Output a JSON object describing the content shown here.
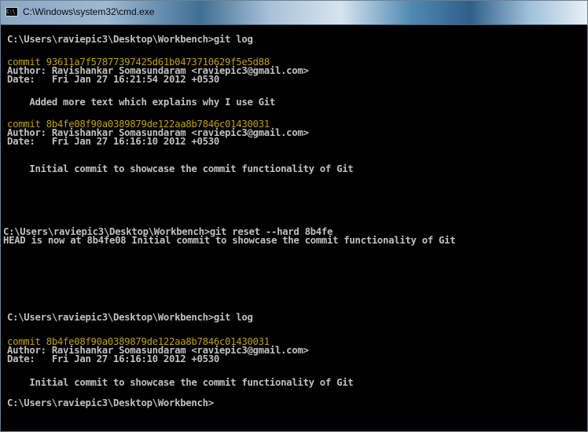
{
  "window": {
    "title": "C:\\Windows\\system32\\cmd.exe",
    "icon": "cmd-icon"
  },
  "console": {
    "lines": [
      "C:\\Users\\raviepic3\\Desktop\\Workbench>git log",
      "commit 93611a7f57877397425d61b0473710629f5e5d88",
      "Author: Ravishankar Somasundaram <raviepic3@gmail.com>",
      "Date:   Fri Jan 27 16:21:54 2012 +0530",
      "    Added more text which explains why I use Git",
      "commit 8b4fe08f90a0389879de122aa8b7846c01430031",
      "Author: Ravishankar Somasundaram <raviepic3@gmail.com>",
      "Date:   Fri Jan 27 16:16:10 2012 +0530",
      "    Initial commit to showcase the commit functionality of Git",
      "C:\\Users\\raviepic3\\Desktop\\Workbench>git reset --hard 8b4fe",
      "HEAD is now at 8b4fe08 Initial commit to showcase the commit functionality of Git",
      "C:\\Users\\raviepic3\\Desktop\\Workbench>git log",
      "commit 8b4fe08f90a0389879de122aa8b7846c01430031",
      "Author: Ravishankar Somasundaram <raviepic3@gmail.com>",
      "Date:   Fri Jan 27 16:16:10 2012 +0530",
      "    Initial commit to showcase the commit functionality of Git",
      "C:\\Users\\raviepic3\\Desktop\\Workbench>"
    ],
    "colors": {
      "background": "#000000",
      "text": "#c0c0c0",
      "commit_hash": "#c4a000"
    }
  }
}
